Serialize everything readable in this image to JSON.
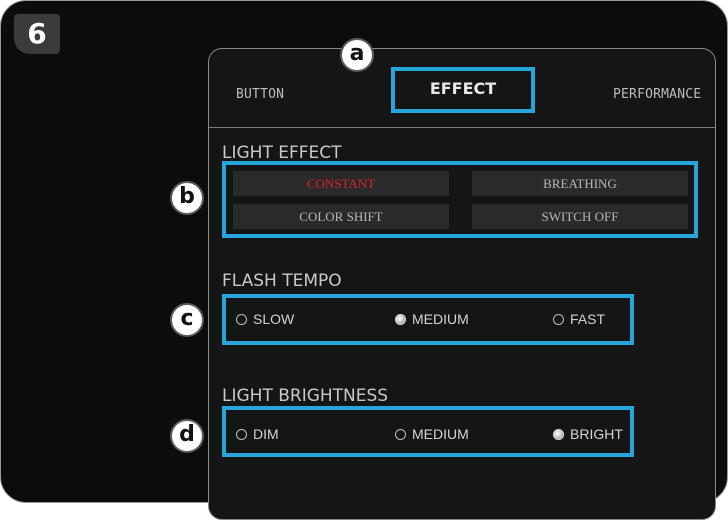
{
  "step_badge": "6",
  "tabs": {
    "button": "BUTTON",
    "effect": "EFFECT",
    "performance": "PERFORMANCE"
  },
  "callouts": {
    "a": "a",
    "b": "b",
    "c": "c",
    "d": "d"
  },
  "light_effect": {
    "title": "LIGHT EFFECT",
    "options": [
      "CONSTANT",
      "BREATHING",
      "COLOR SHIFT",
      "SWITCH OFF"
    ],
    "selected": "CONSTANT"
  },
  "flash_tempo": {
    "title": "FLASH TEMPO",
    "options": [
      "SLOW",
      "MEDIUM",
      "FAST"
    ],
    "selected": "MEDIUM"
  },
  "light_brightness": {
    "title": "LIGHT BRIGHTNESS",
    "options": [
      "DIM",
      "MEDIUM",
      "BRIGHT"
    ],
    "selected": "BRIGHT"
  },
  "colors": {
    "highlight": "#27a6dc",
    "active_text": "#e0202a",
    "background": "#0c0c0c"
  }
}
